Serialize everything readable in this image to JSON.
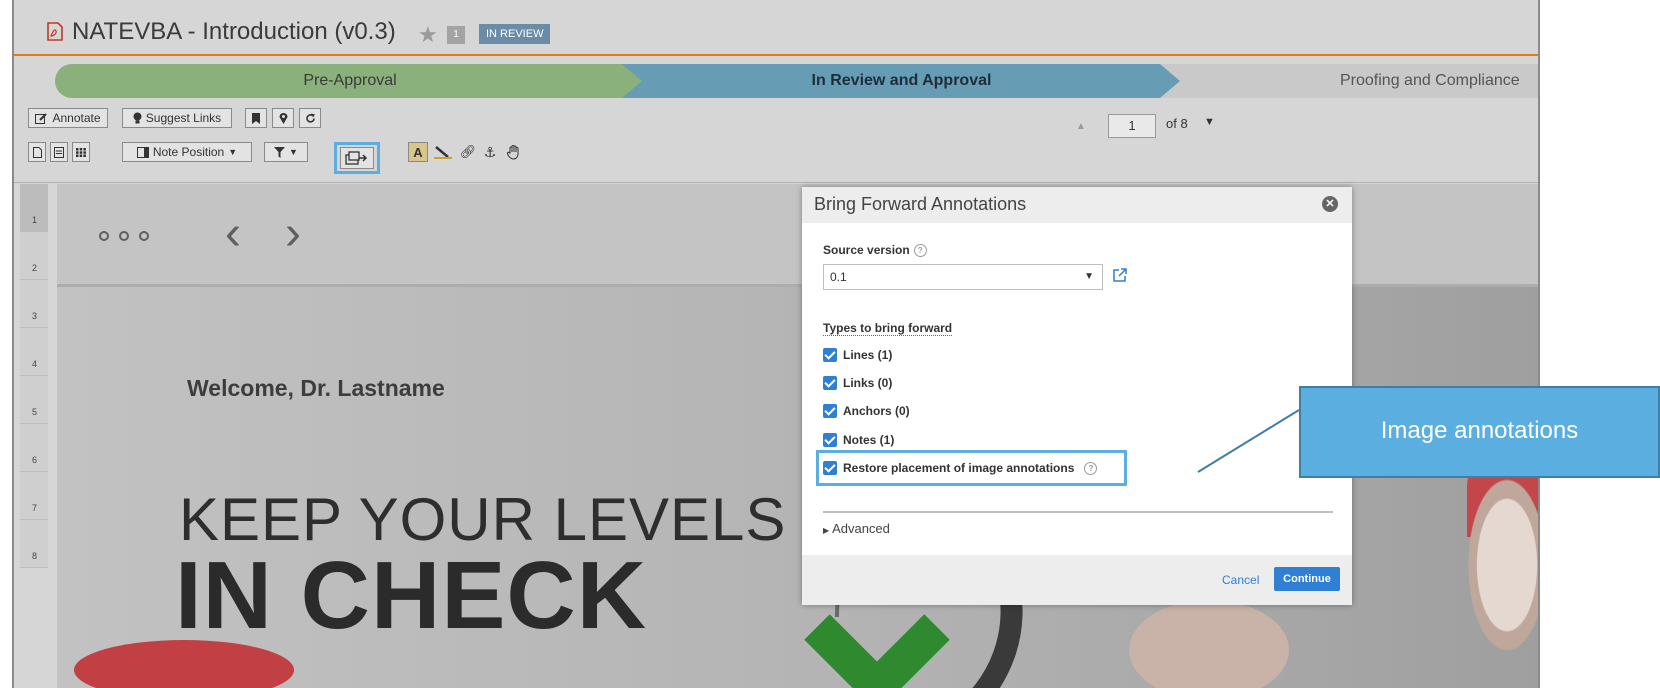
{
  "header": {
    "title": "NATEVBA - Introduction (v0.3)",
    "count_badge": "1",
    "status_badge": "IN REVIEW"
  },
  "workflow": {
    "stages": [
      {
        "label": "Pre-Approval",
        "color": "#8ab07b"
      },
      {
        "label": "In Review and Approval",
        "color": "#669cb4",
        "active": true
      },
      {
        "label": "Proofing and Compliance",
        "color": "#c9c9c9"
      }
    ]
  },
  "toolbar": {
    "annotate_label": "Annotate",
    "suggest_links_label": "Suggest Links",
    "note_position_label": "Note Position",
    "icons": [
      "bookmark-icon",
      "location-pin-icon",
      "refresh-icon",
      "single-page-icon",
      "text-view-icon",
      "grid-view-icon",
      "filter-icon",
      "bring-forward-icon",
      "text-annotation-icon",
      "pencil-icon",
      "link-icon",
      "anchor-icon",
      "hand-tool-icon"
    ]
  },
  "pager": {
    "current_page": "1",
    "of_label": "of 8"
  },
  "page_rail": [
    "1",
    "2",
    "3",
    "4",
    "5",
    "6",
    "7",
    "8"
  ],
  "document": {
    "welcome": "Welcome, Dr. Lastname",
    "headline_1": "KEEP YOUR LEVELS",
    "headline_2": "IN CHECK"
  },
  "modal": {
    "title": "Bring Forward Annotations",
    "source_version_label": "Source version",
    "source_version_value": "0.1",
    "types_label": "Types to bring forward",
    "options": [
      {
        "label": "Lines (1)",
        "checked": true
      },
      {
        "label": "Links (0)",
        "checked": true
      },
      {
        "label": "Anchors (0)",
        "checked": true
      },
      {
        "label": "Notes (1)",
        "checked": true
      },
      {
        "label": "Restore placement of image annotations",
        "checked": true
      }
    ],
    "advanced_label": "Advanced",
    "cancel_label": "Cancel",
    "continue_label": "Continue"
  },
  "callout": {
    "text": "Image annotations"
  },
  "colors": {
    "accent": "#2f7fd4",
    "highlight": "#5aaee0",
    "header_rule": "#e07b1a"
  }
}
